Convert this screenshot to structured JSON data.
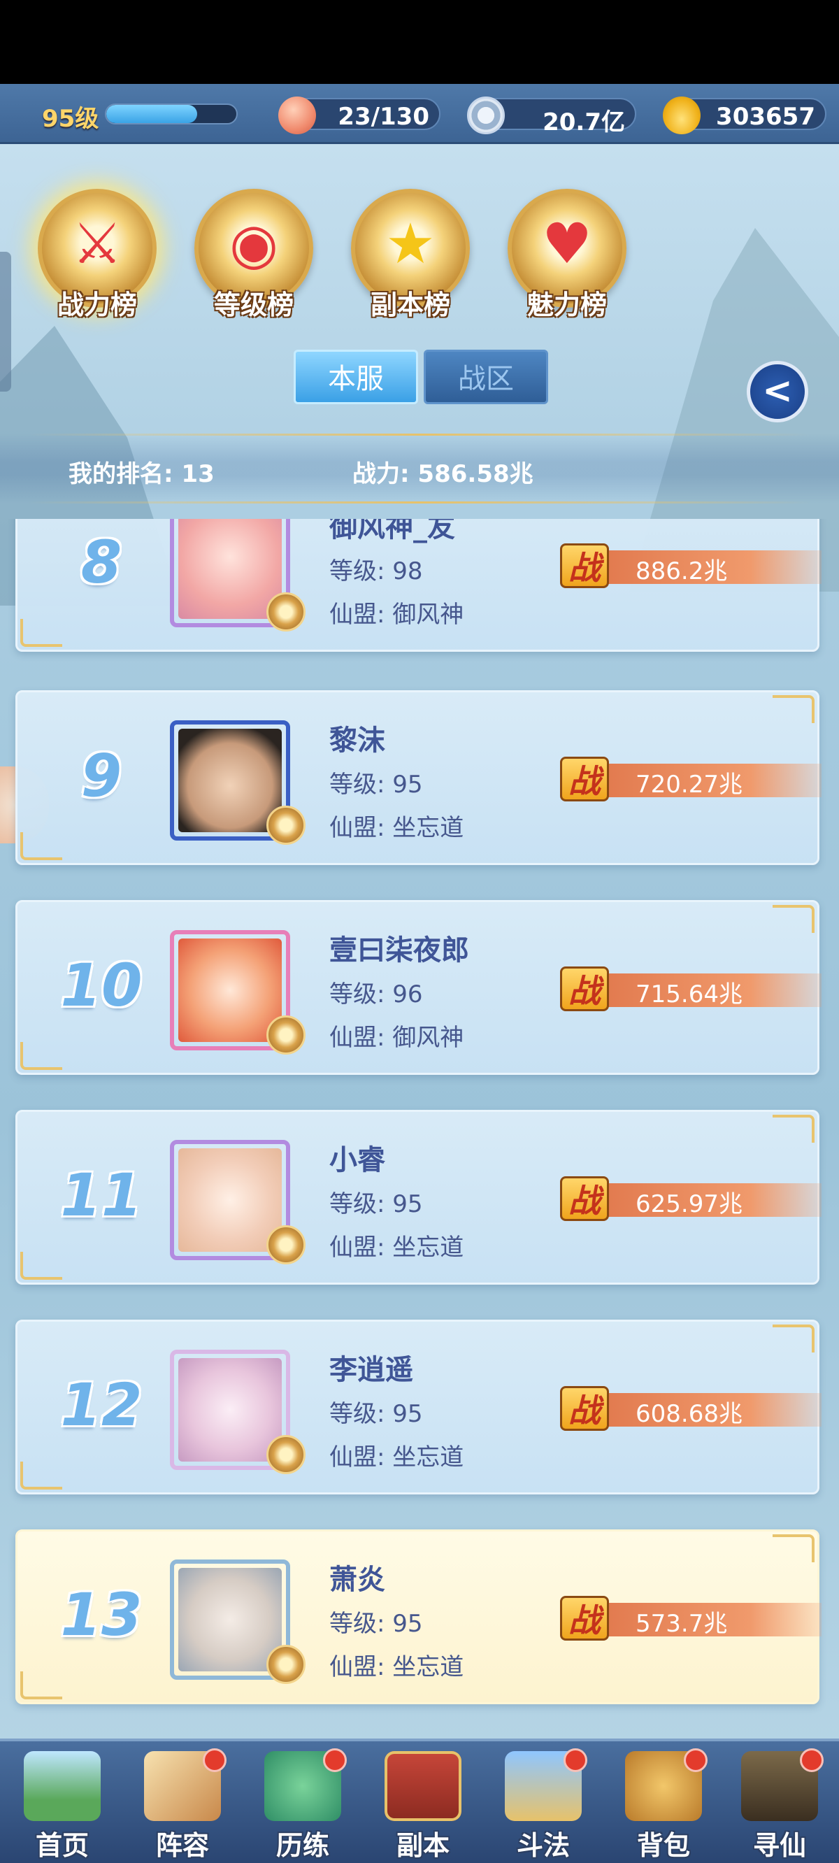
{
  "resources": {
    "level_label": "95级",
    "level_progress": 0.7,
    "stamina": "23/130",
    "copper": "20.7亿",
    "gold": "303657"
  },
  "categories": [
    {
      "label": "战力榜",
      "icon": "sword-shield-icon",
      "active": true
    },
    {
      "label": "等级榜",
      "icon": "drum-icon",
      "active": false
    },
    {
      "label": "副本榜",
      "icon": "star-icon",
      "active": false
    },
    {
      "label": "魅力榜",
      "icon": "heart-icon",
      "active": false
    }
  ],
  "server_tabs": {
    "local": "本服",
    "zone": "战区"
  },
  "my_rank": {
    "rank_text": "我的排名: 13",
    "power_text": "战力: 586.58兆"
  },
  "rows": [
    {
      "rank": "8",
      "name": "御风神_友",
      "level": "等级: 98",
      "alliance": "仙盟: 御风神",
      "power": "886.2兆"
    },
    {
      "rank": "9",
      "name": "黎沫",
      "level": "等级: 95",
      "alliance": "仙盟: 坐忘道",
      "power": "720.27兆"
    },
    {
      "rank": "10",
      "name": "壹曰柒夜郎",
      "level": "等级: 96",
      "alliance": "仙盟: 御风神",
      "power": "715.64兆"
    },
    {
      "rank": "11",
      "name": "小睿",
      "level": "等级: 95",
      "alliance": "仙盟: 坐忘道",
      "power": "625.97兆"
    },
    {
      "rank": "12",
      "name": "李逍遥",
      "level": "等级: 95",
      "alliance": "仙盟: 坐忘道",
      "power": "608.68兆"
    },
    {
      "rank": "13",
      "name": "萧炎",
      "level": "等级: 95",
      "alliance": "仙盟: 坐忘道",
      "power": "573.7兆"
    }
  ],
  "power_glyph": "战",
  "nav": [
    {
      "label": "首页",
      "icon": "home-icon"
    },
    {
      "label": "阵容",
      "icon": "lineup-icon"
    },
    {
      "label": "历练",
      "icon": "training-icon"
    },
    {
      "label": "副本",
      "icon": "dungeon-icon"
    },
    {
      "label": "斗法",
      "icon": "duel-icon"
    },
    {
      "label": "背包",
      "icon": "bag-icon"
    },
    {
      "label": "寻仙",
      "icon": "seek-icon"
    }
  ]
}
